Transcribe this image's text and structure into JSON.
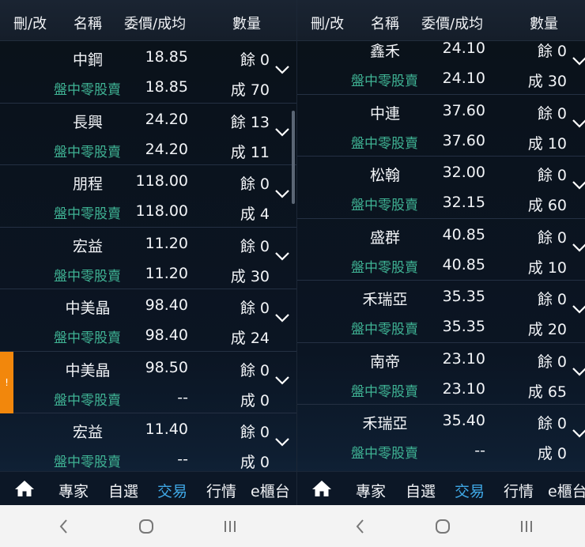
{
  "header": {
    "col_delete": "刪/改",
    "col_name": "名稱",
    "col_price": "委價/成均",
    "col_qty": "數量"
  },
  "sub_label": "盤中零股賣",
  "left_orders": [
    {
      "name": "中鋼",
      "order_price": "18.85",
      "remain": "餘 0",
      "avg_price": "18.85",
      "filled": "成 70"
    },
    {
      "name": "長興",
      "order_price": "24.20",
      "remain": "餘 13",
      "avg_price": "24.20",
      "filled": "成 11"
    },
    {
      "name": "朋程",
      "order_price": "118.00",
      "remain": "餘 0",
      "avg_price": "118.00",
      "filled": "成 4"
    },
    {
      "name": "宏益",
      "order_price": "11.20",
      "remain": "餘 0",
      "avg_price": "11.20",
      "filled": "成 30"
    },
    {
      "name": "中美晶",
      "order_price": "98.40",
      "remain": "餘 0",
      "avg_price": "98.40",
      "filled": "成 24"
    },
    {
      "name": "中美晶",
      "order_price": "98.50",
      "remain": "餘 0",
      "avg_price": "--",
      "filled": "成 0",
      "alert": "!"
    },
    {
      "name": "宏益",
      "order_price": "11.40",
      "remain": "餘 0",
      "avg_price": "--",
      "filled": "成 0"
    }
  ],
  "right_orders": [
    {
      "name": "鑫禾",
      "order_price": "24.10",
      "remain": "餘 0",
      "avg_price": "24.10",
      "filled": "成 30"
    },
    {
      "name": "中連",
      "order_price": "37.60",
      "remain": "餘 0",
      "avg_price": "37.60",
      "filled": "成 10"
    },
    {
      "name": "松翰",
      "order_price": "32.00",
      "remain": "餘 0",
      "avg_price": "32.15",
      "filled": "成 60"
    },
    {
      "name": "盛群",
      "order_price": "40.85",
      "remain": "餘 0",
      "avg_price": "40.85",
      "filled": "成 10"
    },
    {
      "name": "禾瑞亞",
      "order_price": "35.35",
      "remain": "餘 0",
      "avg_price": "35.35",
      "filled": "成 20"
    },
    {
      "name": "南帝",
      "order_price": "23.10",
      "remain": "餘 0",
      "avg_price": "23.10",
      "filled": "成 65"
    },
    {
      "name": "禾瑞亞",
      "order_price": "35.40",
      "remain": "餘 0",
      "avg_price": "--",
      "filled": "成 0"
    }
  ],
  "tabbar": {
    "home_icon": "home-icon",
    "expert": "專家",
    "watchlist": "自選",
    "trade": "交易",
    "market": "行情",
    "ecounter": "e櫃台",
    "active": "trade"
  },
  "colors": {
    "accent": "#3fa8e6",
    "green": "#3fb394",
    "alert": "#f2870c",
    "background": "#0b1220"
  },
  "system_nav": {
    "back_icon": "back-chevron-icon",
    "home_icon": "circle-home-icon",
    "recents_icon": "recents-icon"
  }
}
